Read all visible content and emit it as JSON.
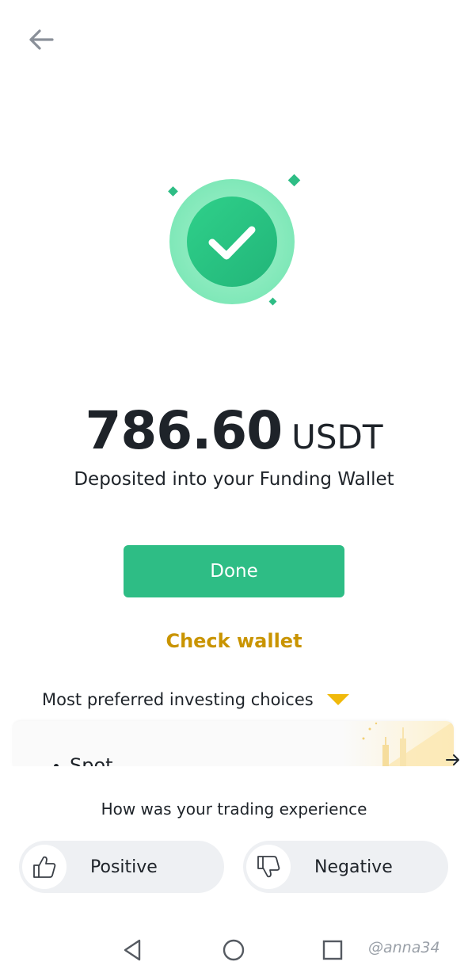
{
  "header": {
    "back_icon": "arrow-left-icon"
  },
  "status": {
    "icon": "checkmark-success-icon",
    "accent": "#2ebd85"
  },
  "deposit": {
    "amount": "786.60",
    "currency": "USDT",
    "message": "Deposited into your Funding Wallet"
  },
  "actions": {
    "done_label": "Done",
    "check_wallet_label": "Check wallet"
  },
  "preferences": {
    "label": "Most preferred investing choices",
    "indicator_icon": "triangle-down-icon",
    "card_title": "Spot",
    "card_arrow_icon": "arrow-right-icon"
  },
  "feedback": {
    "question": "How was your trading experience",
    "positive_label": "Positive",
    "negative_label": "Negative"
  },
  "system_nav": {
    "back_icon": "nav-back-icon",
    "home_icon": "nav-home-icon",
    "recent_icon": "nav-recent-icon",
    "watermark": "@anna34"
  },
  "colors": {
    "primary_green": "#2ebd85",
    "accent_gold": "#c99400",
    "arrow_yellow": "#f0b90b",
    "text_dark": "#1e2329"
  }
}
